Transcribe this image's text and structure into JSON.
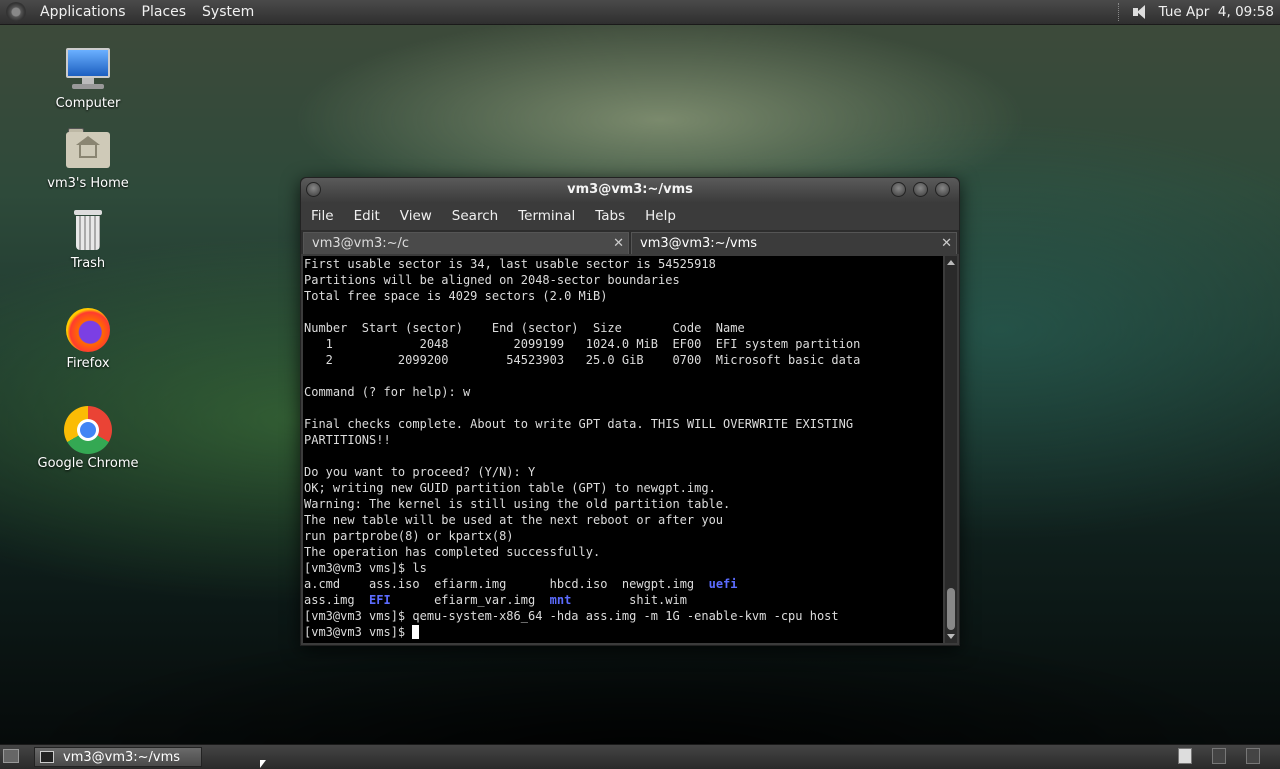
{
  "top_panel": {
    "menus": [
      "Applications",
      "Places",
      "System"
    ],
    "clock": "Tue Apr  4, 09:58"
  },
  "desktop": {
    "icons": [
      {
        "label": "Computer",
        "icon": "computer-icon"
      },
      {
        "label": "vm3's Home",
        "icon": "home-folder-icon"
      },
      {
        "label": "Trash",
        "icon": "trash-icon"
      },
      {
        "label": "Firefox",
        "icon": "firefox-icon"
      },
      {
        "label": "Google Chrome",
        "icon": "chrome-icon"
      }
    ]
  },
  "terminal": {
    "title": "vm3@vm3:~/vms",
    "menu": [
      "File",
      "Edit",
      "View",
      "Search",
      "Terminal",
      "Tabs",
      "Help"
    ],
    "tabs": [
      {
        "label": "vm3@vm3:~/c",
        "active": false
      },
      {
        "label": "vm3@vm3:~/vms",
        "active": true
      }
    ],
    "lines": [
      "First usable sector is 34, last usable sector is 54525918",
      "Partitions will be aligned on 2048-sector boundaries",
      "Total free space is 4029 sectors (2.0 MiB)",
      "",
      "Number  Start (sector)    End (sector)  Size       Code  Name",
      "   1            2048         2099199   1024.0 MiB  EF00  EFI system partition",
      "   2         2099200        54523903   25.0 GiB    0700  Microsoft basic data",
      "",
      "Command (? for help): w",
      "",
      "Final checks complete. About to write GPT data. THIS WILL OVERWRITE EXISTING",
      "PARTITIONS!!",
      "",
      "Do you want to proceed? (Y/N): Y",
      "OK; writing new GUID partition table (GPT) to newgpt.img.",
      "Warning: The kernel is still using the old partition table.",
      "The new table will be used at the next reboot or after you",
      "run partprobe(8) or kpartx(8)",
      "The operation has completed successfully.",
      "[vm3@vm3 vms]$ ls"
    ],
    "ls_row1": {
      "a": "a.cmd    ",
      "b": "ass.iso  ",
      "c": "efiarm.img      ",
      "d": "hbcd.iso  ",
      "e": "newgpt.img  ",
      "dir": "uefi"
    },
    "ls_row2": {
      "a": "ass.img  ",
      "dir1": "EFI",
      "b": "      efiarm_var.img  ",
      "dir2": "mnt",
      "c": "        shit.wim"
    },
    "command_line": "[vm3@vm3 vms]$ qemu-system-x86_64 -hda ass.img -m 1G -enable-kvm -cpu host",
    "prompt": "[vm3@vm3 vms]$ "
  },
  "taskbar": {
    "task_label": "vm3@vm3:~/vms"
  }
}
